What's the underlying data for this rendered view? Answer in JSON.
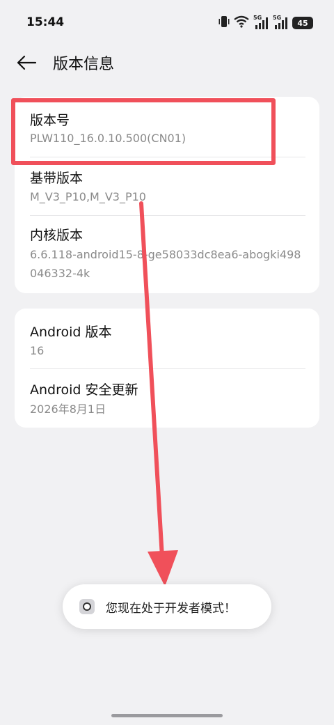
{
  "status_bar": {
    "time": "15:44",
    "signal_label_1": "5G",
    "signal_label_2": "5G",
    "battery": "45",
    "icons": [
      "vibrate-icon",
      "wifi-icon",
      "signal-5g-icon",
      "signal-5g-icon",
      "battery-icon"
    ]
  },
  "header": {
    "title": "版本信息",
    "back_icon": "back-arrow-icon"
  },
  "card1": {
    "items": [
      {
        "title": "版本号",
        "value": "PLW110_16.0.10.500(CN01)"
      },
      {
        "title": "基带版本",
        "value": "M_V3_P10,M_V3_P10"
      },
      {
        "title": "内核版本",
        "value": "6.6.118-android15-8-ge58033dc8ea6-abogki498046332-4k"
      }
    ]
  },
  "card2": {
    "items": [
      {
        "title": "Android 版本",
        "value": "16"
      },
      {
        "title": "Android 安全更新",
        "value": "2026年8月1日"
      }
    ]
  },
  "toast": {
    "icon": "app-icon",
    "message": "您现在处于开发者模式！"
  },
  "colors": {
    "background": "#f1f1f3",
    "card": "#ffffff",
    "annotation": "#f0505a",
    "secondary_text": "#8a8a8a"
  }
}
